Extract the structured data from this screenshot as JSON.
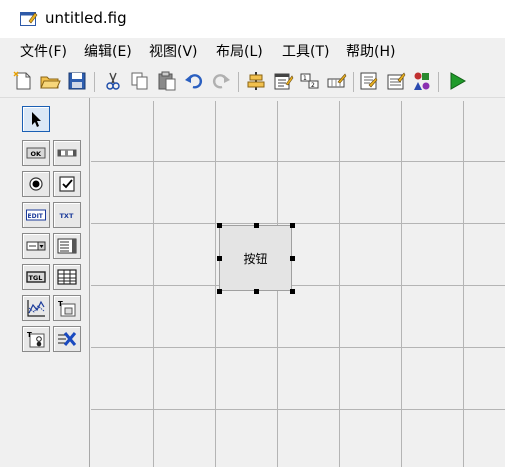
{
  "window": {
    "title": "untitled.fig"
  },
  "menu": {
    "items": [
      {
        "label": "文件(F)"
      },
      {
        "label": "编辑(E)"
      },
      {
        "label": "视图(V)"
      },
      {
        "label": "布局(L)"
      },
      {
        "label": "工具(T)"
      },
      {
        "label": "帮助(H)"
      }
    ]
  },
  "toolbar": {
    "buttons": [
      "new-file-icon",
      "open-folder-icon",
      "save-icon",
      "cut-icon",
      "copy-icon",
      "paste-icon",
      "undo-icon",
      "redo-icon",
      "align-objects-icon",
      "menu-editor-icon",
      "tab-order-editor-icon",
      "toolbar-editor-icon",
      "m-file-editor-icon",
      "property-inspector-icon",
      "object-browser-icon",
      "run-icon"
    ]
  },
  "palette": {
    "tools": [
      "select-arrow-icon",
      "push-button-icon",
      "slider-icon",
      "radio-button-icon",
      "checkbox-icon",
      "edit-text-icon",
      "static-text-icon",
      "popup-menu-icon",
      "listbox-icon",
      "toggle-button-icon",
      "table-icon",
      "axes-icon",
      "panel-icon",
      "button-group-icon",
      "activex-control-icon"
    ],
    "labels": {
      "ok": "OK",
      "edit": "EDIT",
      "txt": "TXT",
      "tgl": "TGL",
      "t": "T"
    }
  },
  "canvas": {
    "button": {
      "label": "按钮"
    }
  },
  "colors": {
    "selection": "#1a5fb4",
    "grid": "#b4b4b4",
    "run": "#1f9a2a"
  }
}
